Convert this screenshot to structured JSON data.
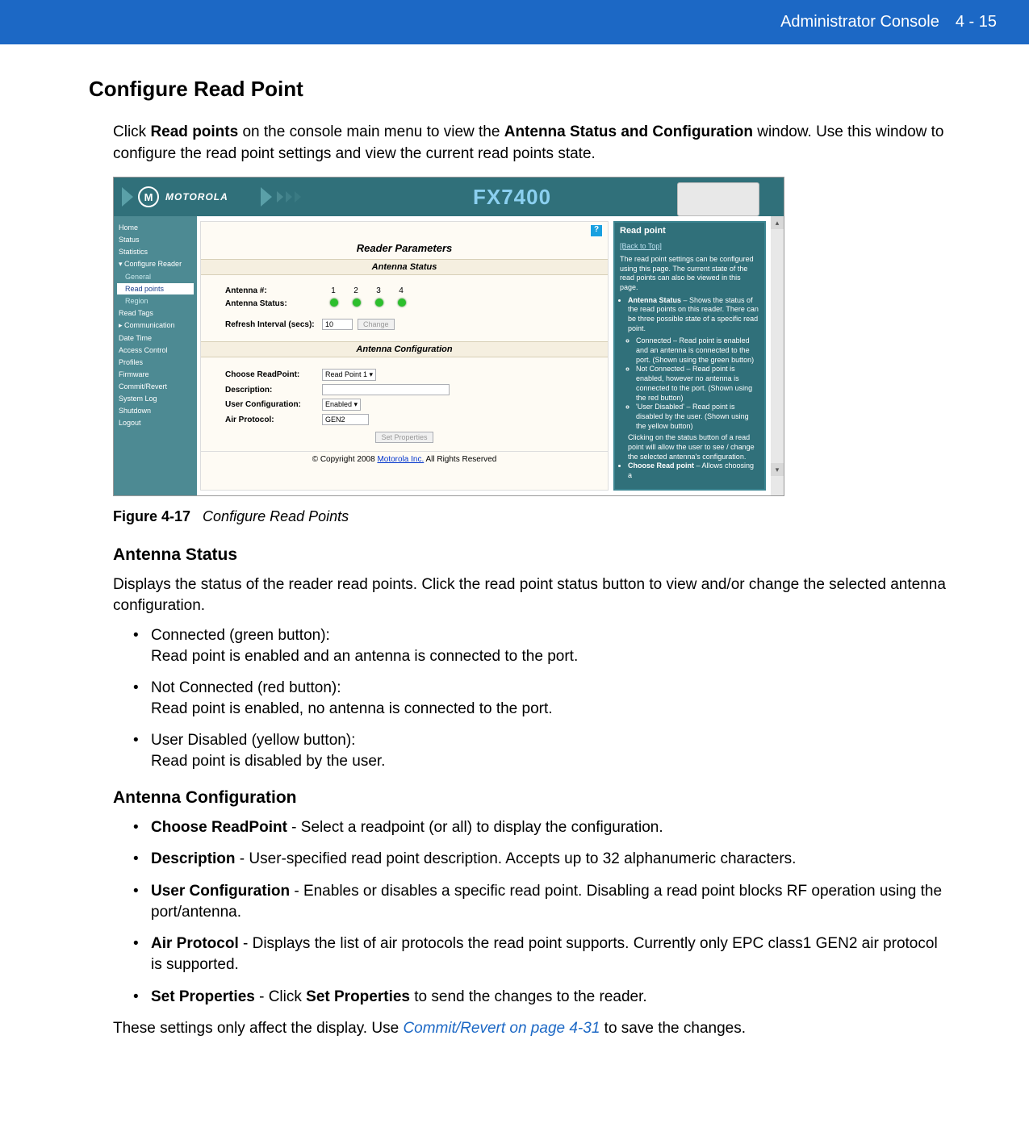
{
  "header": {
    "title": "Administrator Console",
    "pageloc": "4 - 15"
  },
  "section_title": "Configure Read Point",
  "intro_pre": "Click ",
  "intro_b1": "Read points",
  "intro_mid": " on the console main menu to view the ",
  "intro_b2": "Antenna Status and Configuration",
  "intro_post": " window. Use this window to configure the read point settings and view the current read points state.",
  "fig": {
    "brand": "MOTOROLA",
    "model": "FX7400",
    "center_title": "Reader Parameters",
    "sec1": "Antenna Status",
    "antenna_num_lbl": "Antenna #:",
    "antenna_status_lbl": "Antenna Status:",
    "nums": [
      "1",
      "2",
      "3",
      "4"
    ],
    "refresh_lbl": "Refresh Interval (secs):",
    "refresh_val": "10",
    "change_btn": "Change",
    "sec2": "Antenna Configuration",
    "choose_lbl": "Choose ReadPoint:",
    "choose_val": "Read Point 1 ▾",
    "desc_lbl": "Description:",
    "desc_val": "",
    "usercfg_lbl": "User Configuration:",
    "usercfg_val": "Enabled ▾",
    "airproto_lbl": "Air Protocol:",
    "airproto_val": "GEN2",
    "setprops_btn": "Set Properties",
    "copyright_pre": "© Copyright 2008 ",
    "copyright_link": "Motorola Inc.",
    "copyright_post": " All Rights Reserved",
    "sidebar": {
      "home": "Home",
      "status": "Status",
      "stats": "Statistics",
      "cfg": "▾ Configure Reader",
      "general": "General",
      "readpoints": "Read points",
      "region": "Region",
      "readtags": "Read Tags",
      "comm": "▸ Communication",
      "datetime": "Date Time",
      "access": "Access Control",
      "profiles": "Profiles",
      "firmware": "Firmware",
      "commit": "Commit/Revert",
      "syslog": "System Log",
      "shutdown": "Shutdown",
      "logout": "Logout"
    },
    "help": {
      "title": "Read point",
      "back": "[Back to Top]",
      "intro": "The read point settings can be configured using this page. The current state of the read points can also be viewed in this page.",
      "b1_h": "Antenna Status",
      "b1_t": " – Shows the status of the read points on this reader. There can be three possible state of a specific read point.",
      "s1": "Connected – Read point is enabled and an antenna is connected to the port. (Shown using the green button)",
      "s2": "Not Connected – Read point is enabled, however no antenna is connected to the port. (Shown using the red button)",
      "s3": "'User Disabled' – Read point is disabled by the user. (Shown using the yellow button)",
      "ex": "Clicking on the status button of a read point will allow the user to see / change the selected antenna's configuration.",
      "b2_h": "Choose Read point",
      "b2_t": " – Allows choosing a"
    }
  },
  "fig_label": "Figure 4-17",
  "fig_desc": "Configure Read Points",
  "antenna_status_h": "Antenna Status",
  "antenna_status_p": "Displays the status of the reader read points. Click the read point status button to view and/or change the selected antenna configuration.",
  "bullets1": {
    "a1": "Connected (green button):",
    "a2": "Read point is enabled and an antenna is connected to the port.",
    "b1": "Not Connected (red button):",
    "b2": "Read point is enabled, no antenna is connected to the port.",
    "c1": "User Disabled (yellow button):",
    "c2": "Read point is disabled by the user."
  },
  "antenna_cfg_h": "Antenna Configuration",
  "bullets2": {
    "a_b": "Choose ReadPoint",
    "a_t": " - Select a readpoint (or all) to display the configuration.",
    "b_b": "Description",
    "b_t": " - User-specified read point description. Accepts up to 32 alphanumeric characters.",
    "c_b": "User Configuration",
    "c_t": " - Enables or disables a specific read point. Disabling a read point blocks RF operation using the port/antenna.",
    "d_b": "Air Protocol",
    "d_t": " - Displays the list of air protocols the read point supports. Currently only EPC class1 GEN2 air protocol is supported.",
    "e_b": "Set Properties",
    "e_t1": " - Click ",
    "e_b2": "Set Properties",
    "e_t2": " to send the changes to the reader."
  },
  "footer_pre": "These settings only affect the display. Use ",
  "footer_link": "Commit/Revert on page 4-31",
  "footer_post": " to save the changes."
}
